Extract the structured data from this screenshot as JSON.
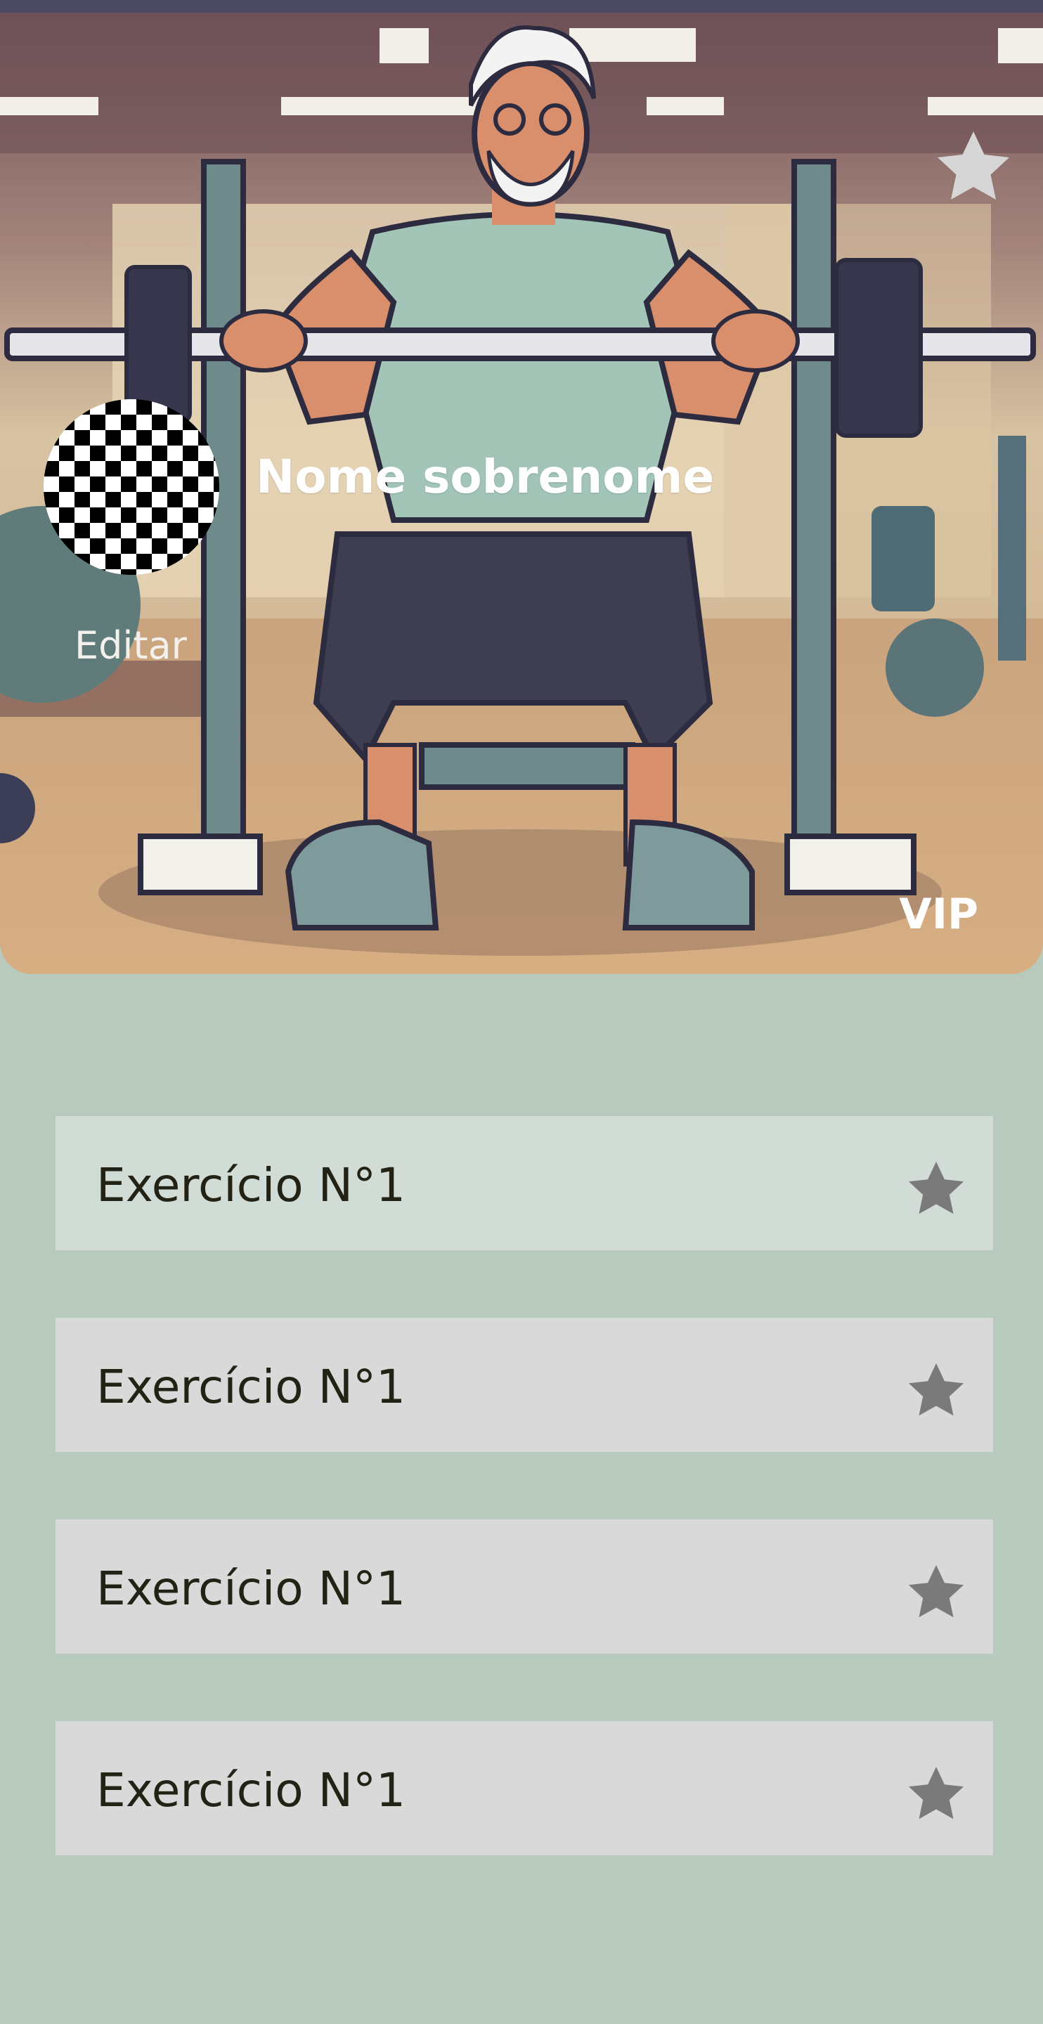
{
  "profile": {
    "name": "Nome sobrenome",
    "edit_label": "Editar",
    "badge": "VIP",
    "favorite_icon": "star-icon"
  },
  "exercises": [
    {
      "label": "Exercício N°1",
      "icon": "star-icon",
      "selected": true
    },
    {
      "label": "Exercício N°1",
      "icon": "star-icon",
      "selected": false
    },
    {
      "label": "Exercício N°1",
      "icon": "star-icon",
      "selected": false
    },
    {
      "label": "Exercício N°1",
      "icon": "star-icon",
      "selected": false
    }
  ],
  "colors": {
    "background": "#b8c9be",
    "item_background": "#d9d9d9",
    "item_selected_background": "#d0dcd5",
    "item_text": "#232315",
    "item_star": "#7a7a7a",
    "header_star": "#d6d6d6"
  }
}
